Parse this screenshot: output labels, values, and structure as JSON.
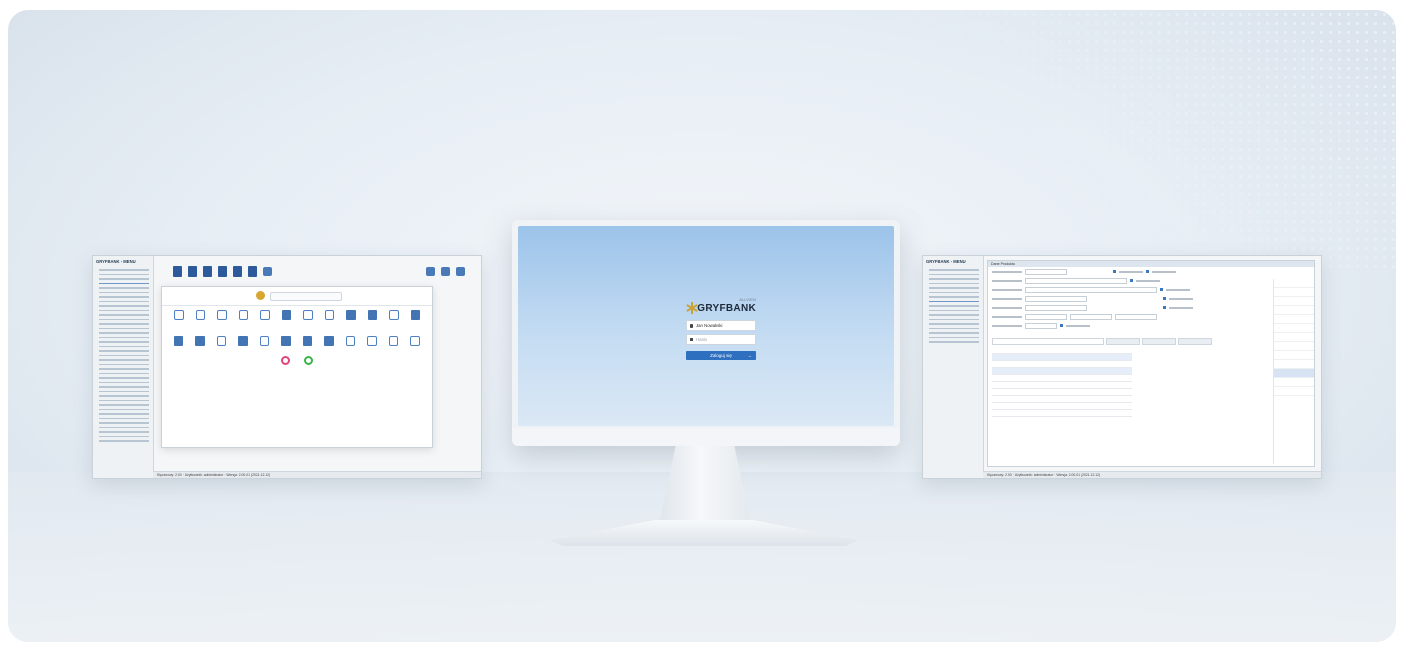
{
  "left_window": {
    "title": "GRYFBANK - MENU",
    "status_text": "Klęcznowy: 2.00 · Użytkownik: administrator · Wersja: 2.00.01 (2021.12.12)"
  },
  "monitor": {
    "brand": {
      "name": "GRYFBANK",
      "subtitle": "ALLVIEN"
    },
    "username_value": "Jan Nowakski",
    "password_placeholder": "Hasło",
    "login_button": "Zaloguj się",
    "login_arrow": "→"
  },
  "right_window": {
    "title": "GRYFBANK - MENU",
    "form_header": "Dane Produktu",
    "status_text": "Klęcznowy: 2.00 · Użytkownik: administrator · Wersja: 2.00.01 (2021.12.12)"
  },
  "colors": {
    "accent": "#2f6fbf",
    "brand_gold": "#c9a23a",
    "icon_blue": "#2c5a9a"
  }
}
